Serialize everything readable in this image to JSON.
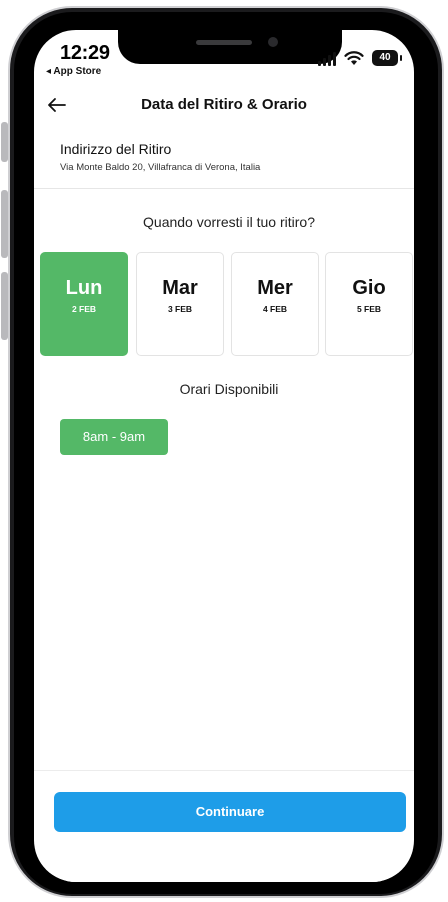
{
  "status_bar": {
    "time": "12:29",
    "back_app": "◂ App Store",
    "battery": "40"
  },
  "header": {
    "title": "Data del Ritiro & Orario"
  },
  "address": {
    "label": "Indirizzo del Ritiro",
    "value": "Via Monte Baldo 20, Villafranca di Verona, Italia"
  },
  "question": "Quando vorresti il tuo ritiro?",
  "days": [
    {
      "name": "Lun",
      "date": "2 FEB",
      "selected": true
    },
    {
      "name": "Mar",
      "date": "3 FEB",
      "selected": false
    },
    {
      "name": "Mer",
      "date": "4 FEB",
      "selected": false
    },
    {
      "name": "Gio",
      "date": "5 FEB",
      "selected": false
    }
  ],
  "slots_label": "Orari Disponibili",
  "slots": [
    {
      "label": "8am - 9am"
    }
  ],
  "continue_label": "Continuare",
  "colors": {
    "accent_green": "#54b867",
    "accent_blue": "#1e9de8"
  }
}
